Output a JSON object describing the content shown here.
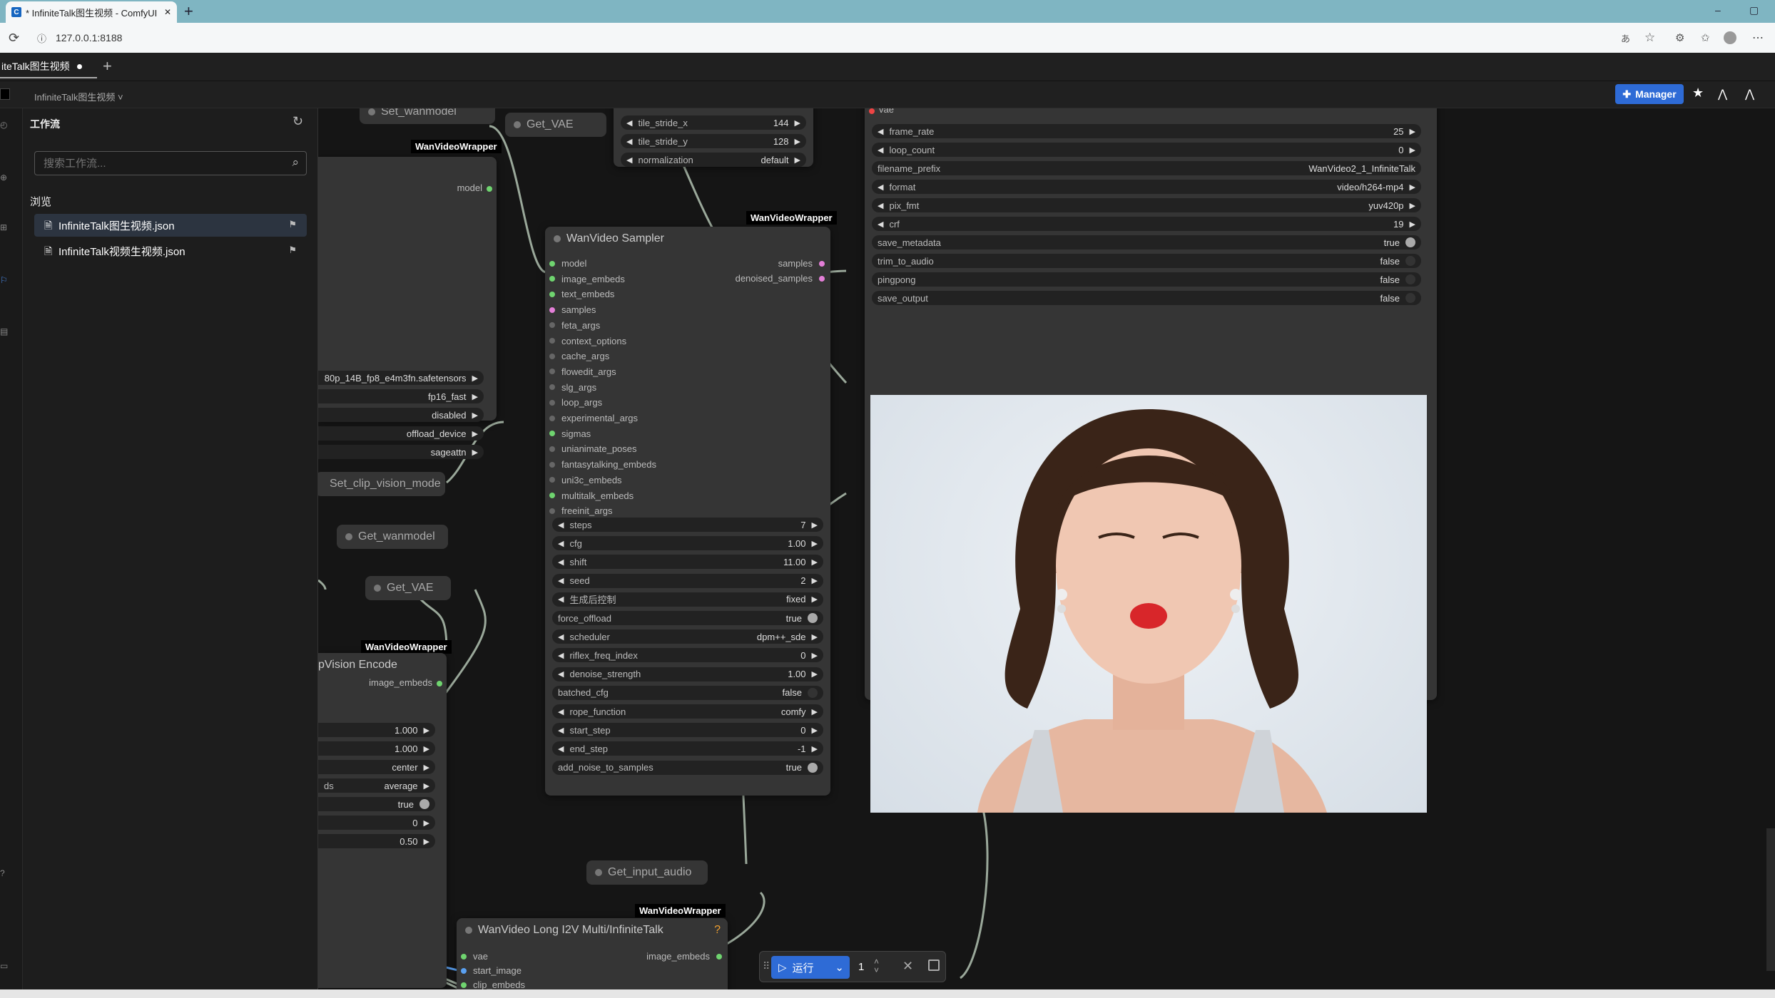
{
  "browser": {
    "tab_title": "* InfiniteTalk图生视频 - ComfyUI",
    "tab_close": "✕",
    "new_tab": "+",
    "url": "127.0.0.1:8188",
    "win_min": "–",
    "win_max": "▢"
  },
  "app": {
    "workflow_tab": "iteTalk图生视频",
    "tab_add": "+",
    "breadcrumb": "InfiniteTalk图生视频 ˅",
    "manager_label": "Manager"
  },
  "sidebar": {
    "title": "工作流",
    "search_placeholder": "搜索工作流...",
    "browse_label": "浏览",
    "files": [
      {
        "name": "InfiniteTalk图生视频.json"
      },
      {
        "name": "InfiniteTalk视频生视频.json"
      }
    ]
  },
  "nodes": {
    "set_wanmodel": "Set_wanmodel",
    "get_vae_top": "Get_VAE",
    "wvw_label": "WanVideoWrapper",
    "model_out": "model",
    "model_loader_widgets": [
      {
        "value": "80p_14B_fp8_e4m3fn.safetensors"
      },
      {
        "value": "fp16_fast"
      },
      {
        "value": "disabled"
      },
      {
        "value": "offload_device"
      },
      {
        "value": "sageattn"
      }
    ],
    "tile": [
      {
        "label": "tile_stride_x",
        "value": "144"
      },
      {
        "label": "tile_stride_y",
        "value": "128"
      },
      {
        "label": "normalization",
        "value": "default"
      }
    ],
    "set_clip_vision_mode": "Set_clip_vision_mode",
    "get_wanmodel": "Get_wanmodel",
    "get_vae_mid": "Get_VAE",
    "clip_vision_title": "pVision Encode",
    "clip_vision_out": "image_embeds",
    "clip_vision_widgets": [
      {
        "label": "",
        "value": "1.000"
      },
      {
        "label": "",
        "value": "1.000"
      },
      {
        "label": "",
        "value": "center"
      },
      {
        "label": "ds",
        "value": "average"
      },
      {
        "label": "",
        "value": "true"
      },
      {
        "label": "",
        "value": "0"
      },
      {
        "label": "",
        "value": "0.50"
      }
    ],
    "sampler_title": "WanVideo Sampler",
    "sampler_inputs": [
      "model",
      "image_embeds",
      "text_embeds",
      "samples",
      "feta_args",
      "context_options",
      "cache_args",
      "flowedit_args",
      "slg_args",
      "loop_args",
      "experimental_args",
      "sigmas",
      "unianimate_poses",
      "fantasytalking_embeds",
      "uni3c_embeds",
      "multitalk_embeds",
      "freeinit_args"
    ],
    "sampler_outputs": [
      "samples",
      "denoised_samples"
    ],
    "sampler_widgets": [
      {
        "label": "steps",
        "value": "7"
      },
      {
        "label": "cfg",
        "value": "1.00"
      },
      {
        "label": "shift",
        "value": "11.00"
      },
      {
        "label": "seed",
        "value": "2"
      },
      {
        "label": "生成后控制",
        "value": "fixed"
      },
      {
        "label": "force_offload",
        "value": "true"
      },
      {
        "label": "scheduler",
        "value": "dpm++_sde"
      },
      {
        "label": "riflex_freq_index",
        "value": "0"
      },
      {
        "label": "denoise_strength",
        "value": "1.00"
      },
      {
        "label": "batched_cfg",
        "value": "false"
      },
      {
        "label": "rope_function",
        "value": "comfy"
      },
      {
        "label": "start_step",
        "value": "0"
      },
      {
        "label": "end_step",
        "value": "-1"
      },
      {
        "label": "add_noise_to_samples",
        "value": "true"
      }
    ],
    "get_input_audio": "Get_input_audio",
    "long_i2v_title": "WanVideo Long I2V Multi/InfiniteTalk",
    "long_i2v_help": "?",
    "long_i2v_inputs": [
      "vae",
      "start_image",
      "clip_embeds"
    ],
    "long_i2v_output": "image_embeds",
    "vhs_top_label": "vae",
    "vhs_widgets": [
      {
        "label": "frame_rate",
        "value": "25"
      },
      {
        "label": "loop_count",
        "value": "0"
      },
      {
        "label": "filename_prefix",
        "value": "WanVideo2_1_InfiniteTalk"
      },
      {
        "label": "format",
        "value": "video/h264-mp4"
      },
      {
        "label": "pix_fmt",
        "value": "yuv420p"
      },
      {
        "label": "crf",
        "value": "19"
      },
      {
        "label": "save_metadata",
        "value": "true"
      },
      {
        "label": "trim_to_audio",
        "value": "false"
      },
      {
        "label": "pingpong",
        "value": "false"
      },
      {
        "label": "save_output",
        "value": "false"
      }
    ]
  },
  "queue": {
    "run_label": "运行",
    "batch_count": "1"
  },
  "colors": {
    "accent": "#2e6bd6",
    "link_pink": "#e880e0",
    "link_blue": "#5aa0f0",
    "slot_green": "#6fd46f",
    "slot_pink": "#e47fd8"
  }
}
